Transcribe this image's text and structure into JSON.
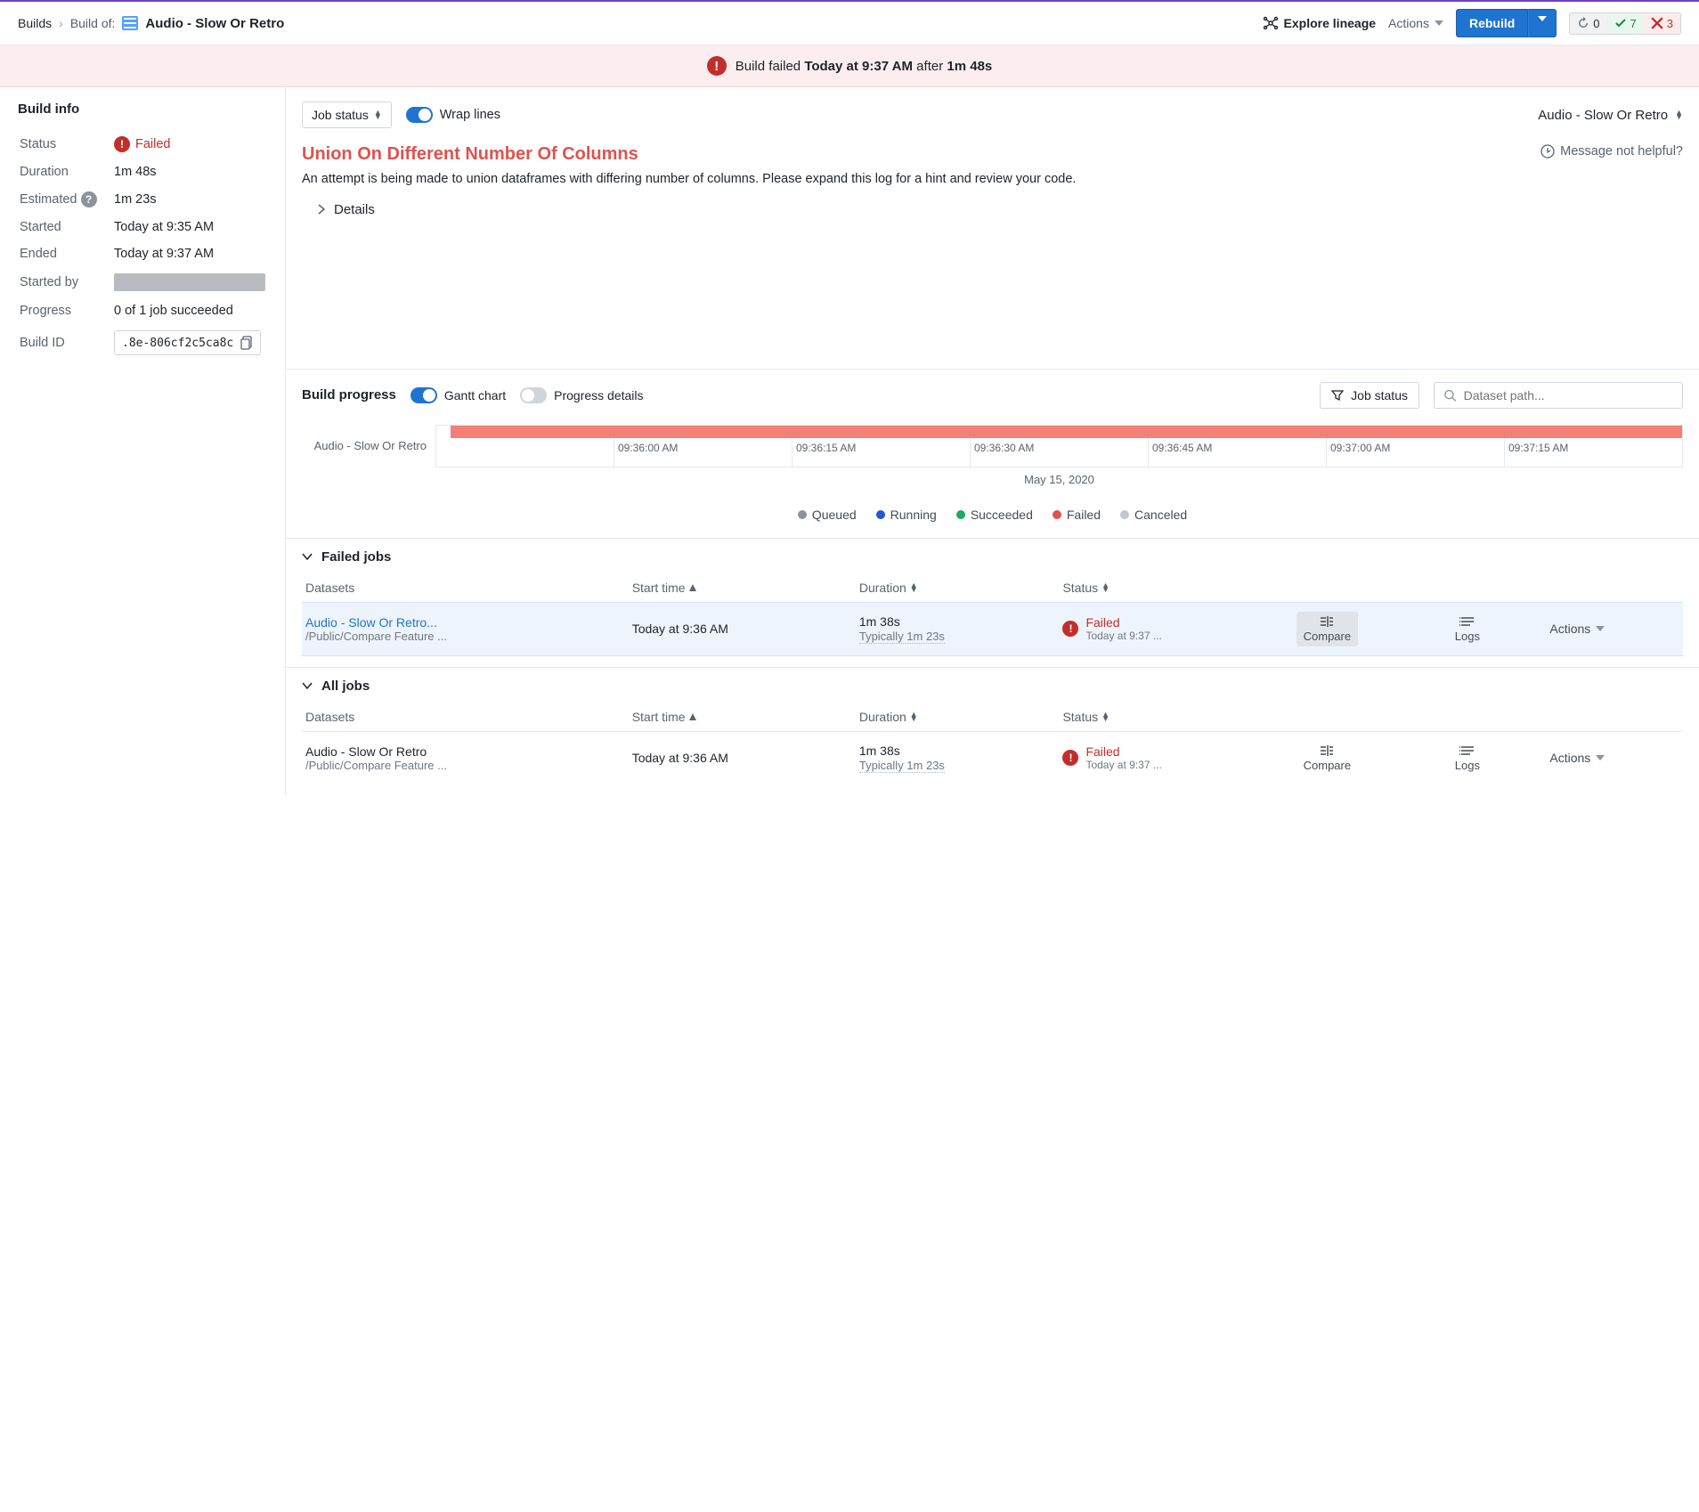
{
  "header": {
    "breadcrumb_root": "Builds",
    "breadcrumb_label": "Build of:",
    "page_title": "Audio - Slow Or Retro",
    "explore_label": "Explore lineage",
    "actions_label": "Actions",
    "rebuild_label": "Rebuild",
    "chip_refresh": "0",
    "chip_success": "7",
    "chip_fail": "3"
  },
  "alert": {
    "prefix": "Build failed ",
    "time": "Today at 9:37 AM",
    "mid": " after ",
    "duration": "1m 48s"
  },
  "sidebar": {
    "title": "Build info",
    "rows": {
      "status_label": "Status",
      "status_value": "Failed",
      "duration_label": "Duration",
      "duration_value": "1m 48s",
      "estimated_label": "Estimated",
      "estimated_value": "1m 23s",
      "started_label": "Started",
      "started_value": "Today at 9:35 AM",
      "ended_label": "Ended",
      "ended_value": "Today at 9:37 AM",
      "startedby_label": "Started by",
      "progress_label": "Progress",
      "progress_value": "0 of 1 job succeeded",
      "buildid_label": "Build ID",
      "buildid_value": ".8e-806cf2c5ca8c"
    }
  },
  "main": {
    "job_status_selector": "Job status",
    "wrap_lines": "Wrap lines",
    "dataset_name": "Audio - Slow Or Retro",
    "error_title": "Union On Different Number Of Columns",
    "error_body": "An attempt is being made to union dataframes with differing number of columns. Please expand this log for a hint and review your code.",
    "msg_not_helpful": "Message not helpful?",
    "details_label": "Details"
  },
  "build_progress": {
    "title": "Build progress",
    "gantt_label": "Gantt chart",
    "progress_details_label": "Progress details",
    "filter_label": "Job status",
    "search_placeholder": "Dataset path...",
    "gantt_row_label": "Audio - Slow Or Retro",
    "ticks": [
      "09:36:00 AM",
      "09:36:15 AM",
      "09:36:30 AM",
      "09:36:45 AM",
      "09:37:00 AM",
      "09:37:15 AM"
    ],
    "date_label": "May 15, 2020",
    "legend": {
      "queued": "Queued",
      "running": "Running",
      "succeeded": "Succeeded",
      "failed": "Failed",
      "canceled": "Canceled"
    }
  },
  "jobs": {
    "failed_title": "Failed jobs",
    "all_title": "All jobs",
    "col_datasets": "Datasets",
    "col_start": "Start time",
    "col_duration": "Duration",
    "col_status": "Status",
    "compare_label": "Compare",
    "logs_label": "Logs",
    "actions_label": "Actions",
    "rows": [
      {
        "name": "Audio - Slow Or Retro...",
        "path": "/Public/Compare Feature ...",
        "start": "Today at 9:36 AM",
        "duration": "1m 38s",
        "typical": "Typically 1m 23s",
        "status": "Failed",
        "status_sub": "Today at 9:37 ..."
      },
      {
        "name": "Audio - Slow Or Retro",
        "path": "/Public/Compare Feature ...",
        "start": "Today at 9:36 AM",
        "duration": "1m 38s",
        "typical": "Typically 1m 23s",
        "status": "Failed",
        "status_sub": "Today at 9:37 ..."
      }
    ]
  }
}
